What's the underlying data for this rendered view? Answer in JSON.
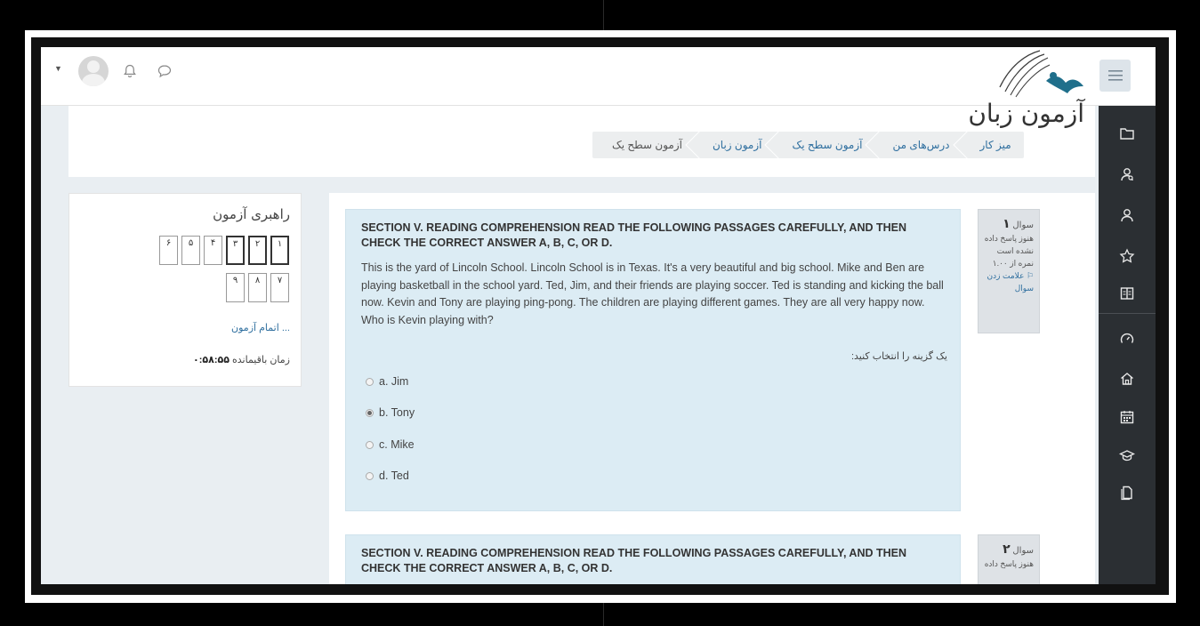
{
  "header": {
    "page_title": "آزمون زبان",
    "breadcrumb": [
      "میز کار",
      "درس‌های من",
      "آزمون سطح یک",
      "آزمون زبان",
      "آزمون سطح یک"
    ]
  },
  "quiz_navigation": {
    "title": "راهبری آزمون",
    "buttons": [
      "۱",
      "۲",
      "۳",
      "۴",
      "۵",
      "۶",
      "۷",
      "۸",
      "۹"
    ],
    "finish_link": "اتمام آزمون ...",
    "time_left_label": "زمان باقیمانده",
    "time_left_value": "۰:۵۸:۵۵"
  },
  "questions": [
    {
      "number_label": "سوال",
      "number": "۱",
      "status": "هنوز پاسخ داده نشده است",
      "mark": "نمره از ۱.۰۰",
      "flag_label": "علامت زدن سوال",
      "heading": "SECTION V. READING COMPREHENSION READ THE FOLLOWING PASSAGES CAREFULLY, AND THEN CHECK THE CORRECT ANSWER A, B, C, OR D.",
      "text": "This is the yard of Lincoln School. Lincoln School is in Texas. It's a very beautiful and big school. Mike and Ben are playing basketball in the school yard. Ted, Jim, and their friends are playing soccer. Ted is standing and kicking the ball now. Kevin and Tony are playing ping-pong. The children are playing different games. They are all very happy now. Who is Kevin playing with?",
      "prompt": "یک گزینه را انتخاب کنید:",
      "options": [
        "a. Jim",
        "b. Tony",
        "c. Mike",
        "d. Ted"
      ],
      "selected": "b. Tony"
    },
    {
      "number_label": "سوال",
      "number": "۲",
      "status": "هنوز پاسخ داده",
      "heading": "SECTION V. READING COMPREHENSION READ THE FOLLOWING PASSAGES CAREFULLY, AND THEN CHECK THE CORRECT ANSWER A, B, C, OR D."
    }
  ],
  "icons": [
    "caret-down-icon",
    "user-avatar",
    "bell-icon",
    "chat-icon",
    "site-logo",
    "hamburger-menu-icon",
    "folder-icon",
    "users-icon",
    "participants-icon",
    "star-icon",
    "book-icon",
    "dashboard-icon",
    "home-icon",
    "calendar-icon",
    "graduation-cap-icon",
    "files-icon"
  ],
  "colors": {
    "accent": "#2f6f9f",
    "question_bg": "#dcecf4",
    "drawer": "#2b2f33"
  }
}
